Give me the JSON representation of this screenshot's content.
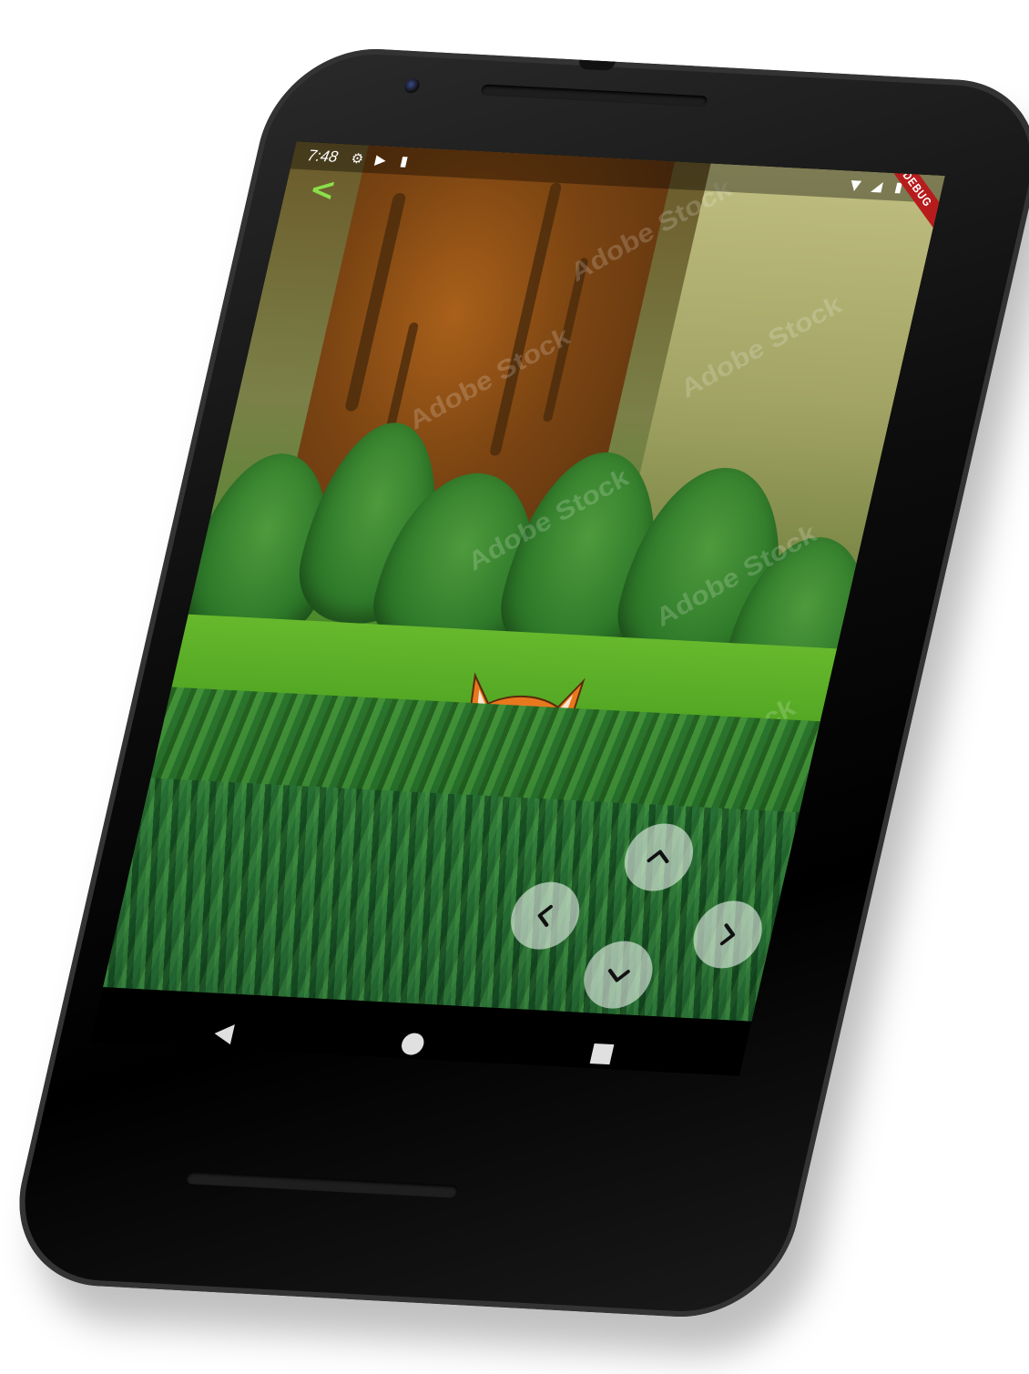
{
  "status_bar": {
    "time": "7:48",
    "left_icons": [
      "gear-icon",
      "play-shield-icon",
      "sd-card-icon"
    ],
    "right_icons": [
      "wifi-icon",
      "signal-icon",
      "battery-icon"
    ],
    "debug_label": "DEBUG"
  },
  "app": {
    "back_icon": "chevron-left-icon",
    "back_color": "#8be04a",
    "watermark": "Adobe Stock"
  },
  "controls": {
    "up": "chevron-up-icon",
    "down": "chevron-down-icon",
    "left": "chevron-left-icon",
    "right": "chevron-right-icon"
  },
  "nav_bar": {
    "back": "triangle-back-icon",
    "home": "circle-home-icon",
    "recents": "square-recents-icon"
  }
}
